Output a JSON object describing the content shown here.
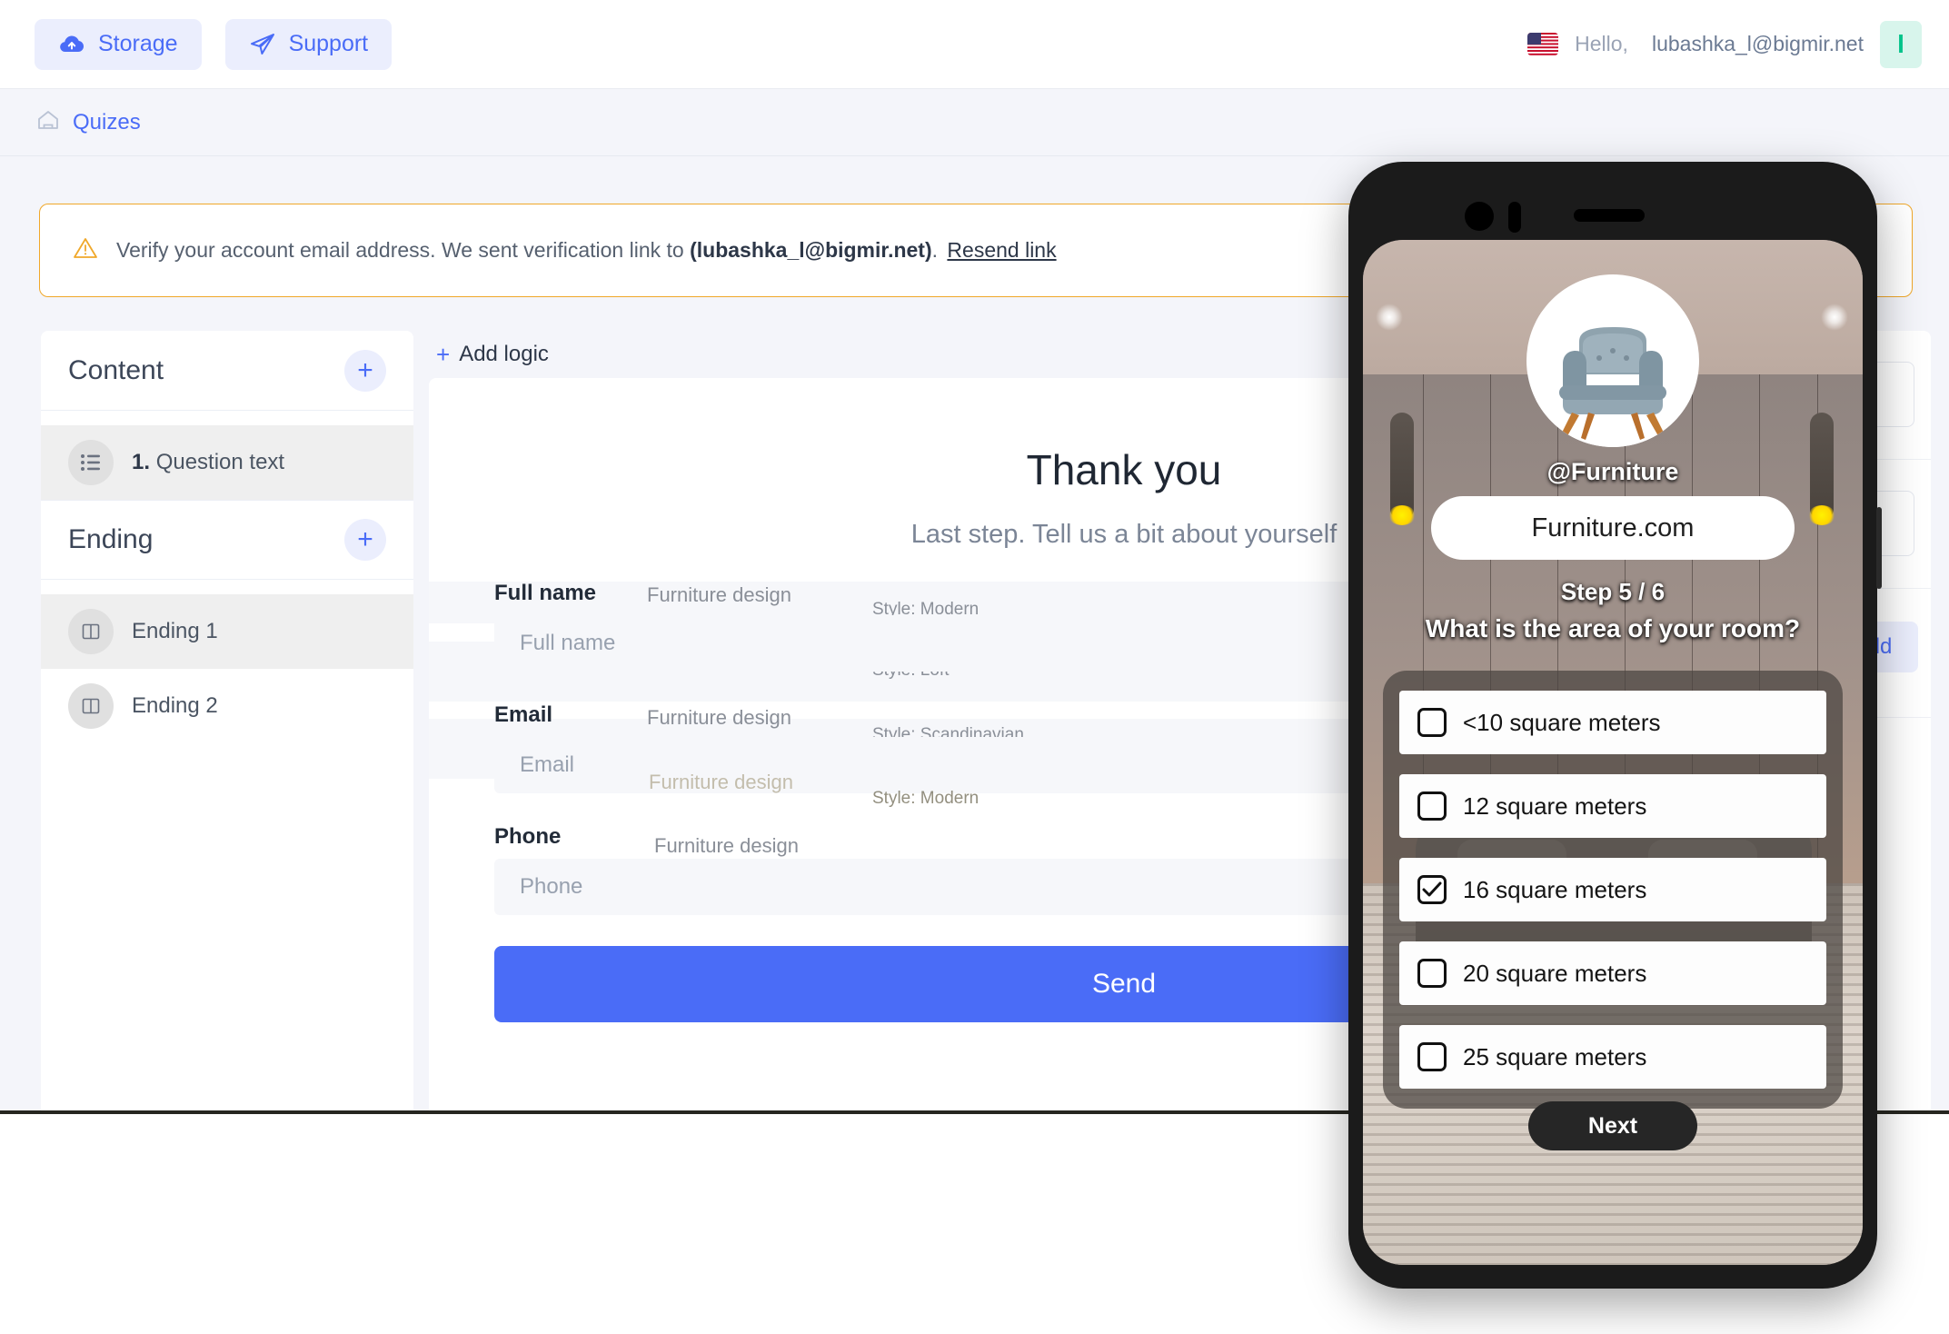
{
  "topbar": {
    "storage_label": "Storage",
    "support_label": "Support",
    "greeting": "Hello,",
    "email": "lubashka_l@bigmir.net",
    "avatar_letter": "l",
    "avatar_bg": "#d8f5ec",
    "avatar_fg": "#00c389",
    "accent": "#4a6cf7"
  },
  "breadcrumb": {
    "label": "Quizes"
  },
  "notice": {
    "text_before": "Verify your account email address. We sent verification link to",
    "email_bold": "(lubashka_l@bigmir.net)",
    "dot": ".",
    "link_label": "Resend link",
    "border_color": "#f0a82a"
  },
  "sidebar": {
    "content": {
      "title": "Content",
      "add_label": "+",
      "items": [
        {
          "num": "1.",
          "label": "Question text",
          "icon": "list-icon",
          "active": true
        }
      ]
    },
    "ending": {
      "title": "Ending",
      "add_label": "+",
      "items": [
        {
          "label": "Ending 1",
          "icon": "layout-icon",
          "active": true
        },
        {
          "label": "Ending 2",
          "icon": "layout-icon",
          "active": false
        }
      ]
    }
  },
  "center": {
    "add_logic_label": "Add logic",
    "add_logic_plus": "+",
    "thankyou": {
      "title": "Thank you",
      "subtitle": "Last step. Tell us a bit about yourself",
      "fields": [
        {
          "label": "Full name",
          "placeholder": "Full name",
          "value": ""
        },
        {
          "label": "Email",
          "placeholder": "Email",
          "value": ""
        },
        {
          "label": "Phone",
          "placeholder": "Phone",
          "value": ""
        }
      ],
      "submit_label": "Send",
      "submit_color": "#4a6cf7"
    },
    "ghost_rows": [
      {
        "name": "Furniture design",
        "style": "Style: Modern"
      },
      {
        "name": "Furniture design",
        "style": "Style: Loft"
      },
      {
        "name": "Furniture design",
        "style": "Style: Scandinavian"
      },
      {
        "name": "Furniture design",
        "style": "Style: Modern"
      },
      {
        "name": "Furniture design",
        "style": ""
      }
    ]
  },
  "rightpanel": {
    "selects": [
      {
        "value": "",
        "chevron": "chevron-down-icon"
      },
      {
        "value": "",
        "chevron": "chevron-down-icon"
      }
    ],
    "add_button_label": "Add field"
  },
  "phone": {
    "brand_handle": "@Furniture",
    "brand_site": "Furniture.com",
    "step_label": "Step 5 / 6",
    "question": "What is the area of your room?",
    "options": [
      {
        "label": "<10 square meters",
        "checked": false
      },
      {
        "label": "12 square meters",
        "checked": false
      },
      {
        "label": "16 square meters",
        "checked": true
      },
      {
        "label": "20 square meters",
        "checked": false
      },
      {
        "label": "25 square meters",
        "checked": false
      }
    ],
    "next_label": "Next"
  }
}
